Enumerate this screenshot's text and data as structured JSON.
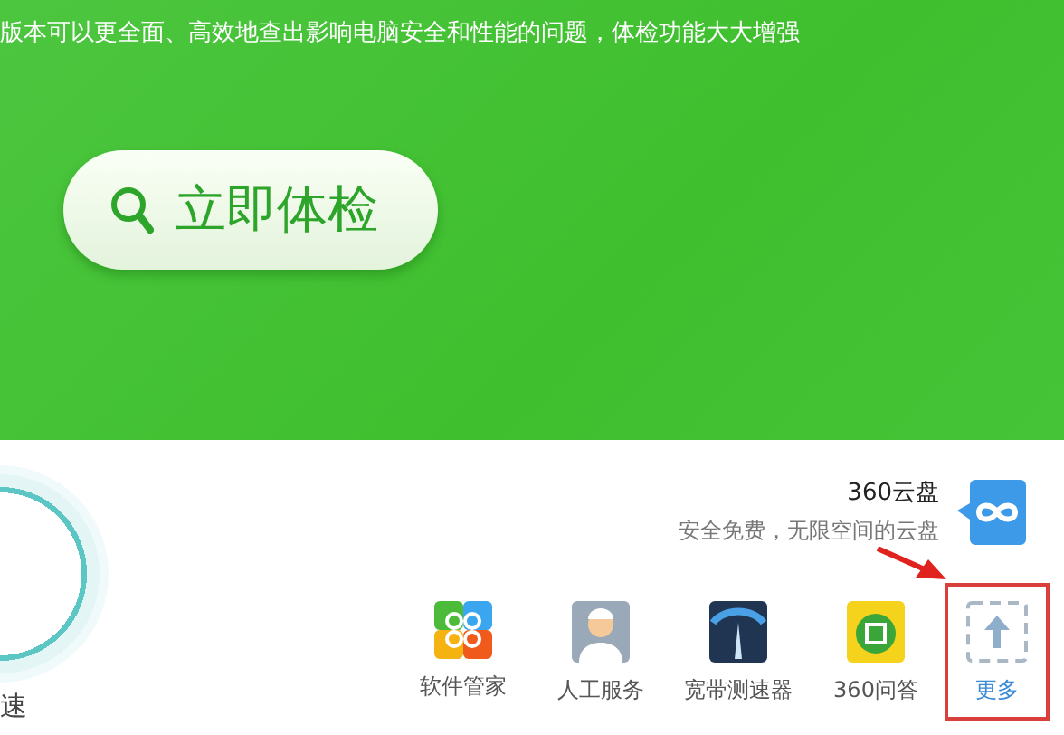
{
  "banner": {
    "description": "版本可以更全面、高效地查出影响电脑安全和性能的问题，体检功能大大增强",
    "scan_button": "立即体检"
  },
  "speedup": {
    "label": "速"
  },
  "cloud": {
    "title": "360云盘",
    "subtitle": "安全免费，无限空间的云盘"
  },
  "tools": [
    {
      "kind": "software",
      "label": "软件管家",
      "highlighted": false
    },
    {
      "kind": "service",
      "label": "人工服务",
      "highlighted": false
    },
    {
      "kind": "speedtest",
      "label": "宽带测速器",
      "highlighted": false
    },
    {
      "kind": "qa",
      "label": "360问答",
      "highlighted": false
    },
    {
      "kind": "more",
      "label": "更多",
      "highlighted": true
    }
  ]
}
